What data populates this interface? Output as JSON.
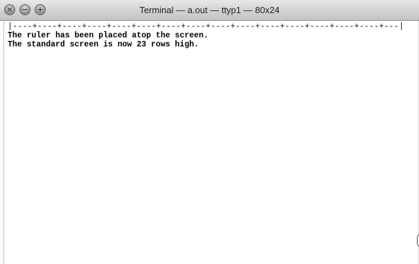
{
  "window": {
    "title": "Terminal — a.out — ttyp1 — 80x24"
  },
  "titlebar": {
    "buttons": [
      {
        "name": "close",
        "icon": "close-icon",
        "glyph": "×"
      },
      {
        "name": "minimize",
        "icon": "minimize-icon",
        "glyph": "−"
      },
      {
        "name": "zoom",
        "icon": "zoom-icon",
        "glyph": "+"
      }
    ]
  },
  "terminal": {
    "ruler": "|----+----+----+----+----+----+----+----+----+----+----+----+----+----+----+---|",
    "lines": [
      "The ruler has been placed atop the screen.",
      "The standard screen is now 23 rows high."
    ],
    "background": "#ffffff",
    "foreground": "#000000"
  }
}
